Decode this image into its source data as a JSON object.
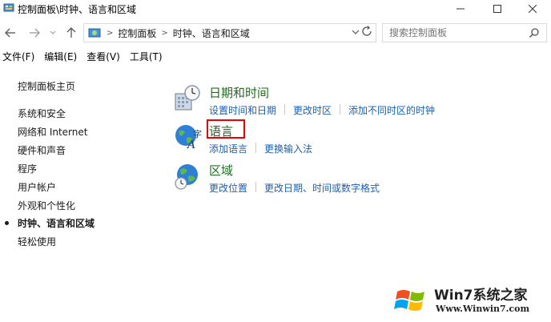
{
  "window": {
    "title": "控制面板\\时钟、语言和区域"
  },
  "address": {
    "crumbs": [
      "控制面板",
      "时钟、语言和区域"
    ],
    "search_placeholder": "搜索控制面板"
  },
  "menu": [
    {
      "label": "文件(F)"
    },
    {
      "label": "编辑(E)"
    },
    {
      "label": "查看(V)"
    },
    {
      "label": "工具(T)"
    }
  ],
  "sidebar": {
    "items": [
      {
        "label": "控制面板主页"
      },
      {
        "label": "系统和安全"
      },
      {
        "label": "网络和 Internet"
      },
      {
        "label": "硬件和声音"
      },
      {
        "label": "程序"
      },
      {
        "label": "用户帐户"
      },
      {
        "label": "外观和个性化"
      },
      {
        "label": "时钟、语言和区域"
      },
      {
        "label": "轻松使用"
      }
    ],
    "active_index": 7
  },
  "categories": [
    {
      "title": "日期和时间",
      "icon": "clock-calendar-icon",
      "links": [
        "设置时间和日期",
        "更改时区",
        "添加不同时区的时钟"
      ]
    },
    {
      "title": "语言",
      "icon": "language-globe-icon",
      "links": [
        "添加语言",
        "更换输入法"
      ]
    },
    {
      "title": "区域",
      "icon": "region-globe-icon",
      "links": [
        "更改位置",
        "更改日期、时间或数字格式"
      ]
    }
  ],
  "watermark": {
    "brand": "Win7系统之家",
    "url": "Www.Winwin7.com"
  },
  "colors": {
    "category_title": "#1e6e1e",
    "link": "#1a5fb4",
    "highlight": "#e00000"
  }
}
